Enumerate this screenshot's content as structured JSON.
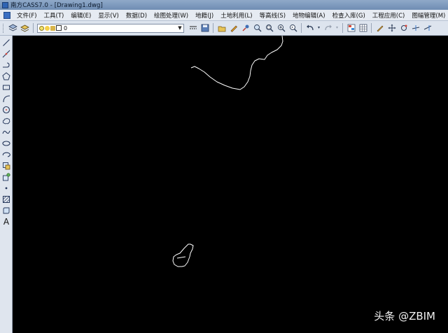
{
  "window": {
    "title": "南方CASS7.0 - [Drawing1.dwg]"
  },
  "menu": [
    "文件(F)",
    "工具(T)",
    "编辑(E)",
    "显示(V)",
    "数据(D)",
    "绘图处理(W)",
    "地籍(J)",
    "土地利用(L)",
    "等高线(S)",
    "地物编辑(A)",
    "检查入库(G)",
    "工程应用(C)",
    "图幅管理(M)"
  ],
  "layer": {
    "current": "0"
  },
  "watermark": "头条 @ZBIM",
  "colors": {
    "canvas": "#000000",
    "drawing_lines": "#ffffff"
  }
}
